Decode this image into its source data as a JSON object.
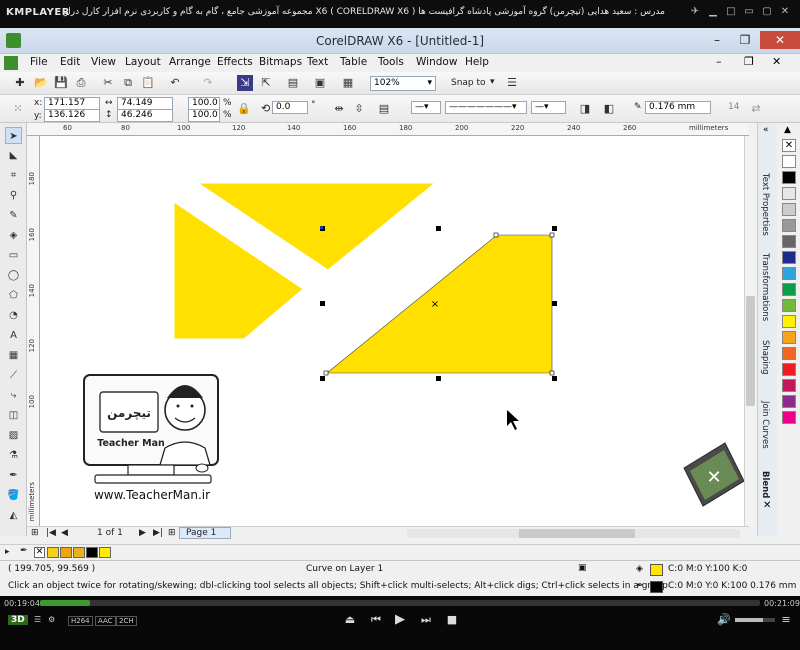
{
  "player": {
    "logo": "KMPLAYER",
    "caption": "مجموعه آموزشی جامع ، گام به گام و کاربردی نرم افزار کارل دراو X6 ( CORELDRAW X6 )   مدرس : سعید هدایی (تیچرمن) گروه آموزشی پادشاه گرافیست ها",
    "time_current": "00:19:04",
    "time_total": "00:21:09",
    "badge_3d": "3D",
    "format_tags": [
      "H264",
      "AAC",
      "2CH"
    ],
    "progress_fraction": 0.07
  },
  "app": {
    "title": "CorelDRAW X6 - [Untitled-1]",
    "menu": [
      "File",
      "Edit",
      "View",
      "Layout",
      "Arrange",
      "Effects",
      "Bitmaps",
      "Text",
      "Table",
      "Tools",
      "Window",
      "Help"
    ]
  },
  "toolbar1": {
    "zoom": "102%",
    "snap_to": "Snap to"
  },
  "propbar": {
    "x_label": "x:",
    "x_value": "171.157 mm",
    "y_label": "y:",
    "y_value": "136.126 mm",
    "w_value": "74.149 mm",
    "h_value": "46.246 mm",
    "scale_x": "100.0",
    "scale_y": "100.0",
    "percent": "%",
    "rotation": "0.0",
    "degree": "°",
    "outline_width": "0.176 mm",
    "font_size": "14"
  },
  "rulers": {
    "h_ticks": [
      "60",
      "80",
      "100",
      "120",
      "140",
      "160",
      "180",
      "200",
      "220",
      "240",
      "260"
    ],
    "h_unit": "millimeters",
    "v_ticks": [
      "180",
      "160",
      "140",
      "120",
      "100"
    ],
    "v_unit": "millimeters"
  },
  "dockers": [
    "Text Properties",
    "Transformations",
    "Shaping",
    "Join Curves",
    "Blend"
  ],
  "palette_colors": [
    "#ffffff",
    "#000000",
    "#e6e6e6",
    "#cccccc",
    "#999999",
    "#666666",
    "#1e2b8c",
    "#2ea3dd",
    "#0d9c48",
    "#72b83b",
    "#fff200",
    "#f7a21b",
    "#f26522",
    "#ed1c24",
    "#c2185b",
    "#8e2a8b",
    "#ec008c"
  ],
  "pager": {
    "page_count": "1 of 1",
    "page_tab": "Page 1"
  },
  "doc_palette": [
    "#f7d117",
    "#f0a30a",
    "#e8b21e",
    "#000000",
    "#fdee00"
  ],
  "status": {
    "coords": "( 199.705, 99.569 )",
    "object_info": "Curve on Layer 1",
    "hint": "Click an object twice for rotating/skewing; dbl-clicking tool selects all objects; Shift+click multi-selects; Alt+click digs; Ctrl+click selects in a group",
    "fill_text": "C:0 M:0 Y:100 K:0",
    "outline_text": "C:0 M:0 Y:0 K:100  0.176 mm",
    "fill_color": "#ffe500",
    "outline_color": "#000000"
  },
  "shape_fill": "#ffe000",
  "watermark": {
    "url": "www.TeacherMan.ir",
    "brand_en": "Teacher Man",
    "brand_fa": "تیچرمن"
  }
}
